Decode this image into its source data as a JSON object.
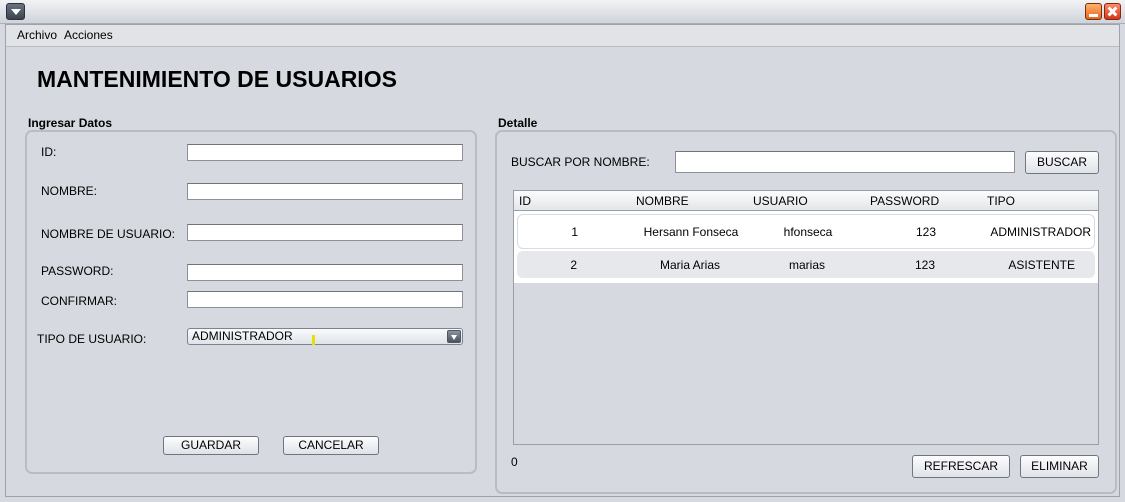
{
  "window": {
    "title": ""
  },
  "menu": {
    "items": [
      "Archivo",
      "Acciones"
    ]
  },
  "page_title": "MANTENIMIENTO DE USUARIOS",
  "form": {
    "section_title": "Ingresar Datos",
    "fields": {
      "id": {
        "label": "ID:",
        "value": ""
      },
      "nombre": {
        "label": "NOMBRE:",
        "value": ""
      },
      "usuario": {
        "label": "NOMBRE DE USUARIO:",
        "value": ""
      },
      "password": {
        "label": "PASSWORD:",
        "value": ""
      },
      "confirmar": {
        "label": "CONFIRMAR:",
        "value": ""
      }
    },
    "tipo": {
      "label": "TIPO DE USUARIO:",
      "selected": "ADMINISTRADOR"
    },
    "buttons": {
      "guardar": "GUARDAR",
      "cancelar": "CANCELAR"
    }
  },
  "detail": {
    "section_title": "Detalle",
    "search_label": "BUSCAR POR NOMBRE:",
    "search_value": "",
    "search_button": "BUSCAR",
    "columns": [
      "ID",
      "NOMBRE",
      "USUARIO",
      "PASSWORD",
      "TIPO"
    ],
    "rows": [
      {
        "id": "1",
        "nombre": "Hersann Fonseca",
        "usuario": "hfonseca",
        "password": "123",
        "tipo": "ADMINISTRADOR"
      },
      {
        "id": "2",
        "nombre": "Maria Arias",
        "usuario": "marias",
        "password": "123",
        "tipo": "ASISTENTE"
      }
    ],
    "count": "0",
    "buttons": {
      "refrescar": "REFRESCAR",
      "eliminar": "ELIMINAR"
    }
  }
}
